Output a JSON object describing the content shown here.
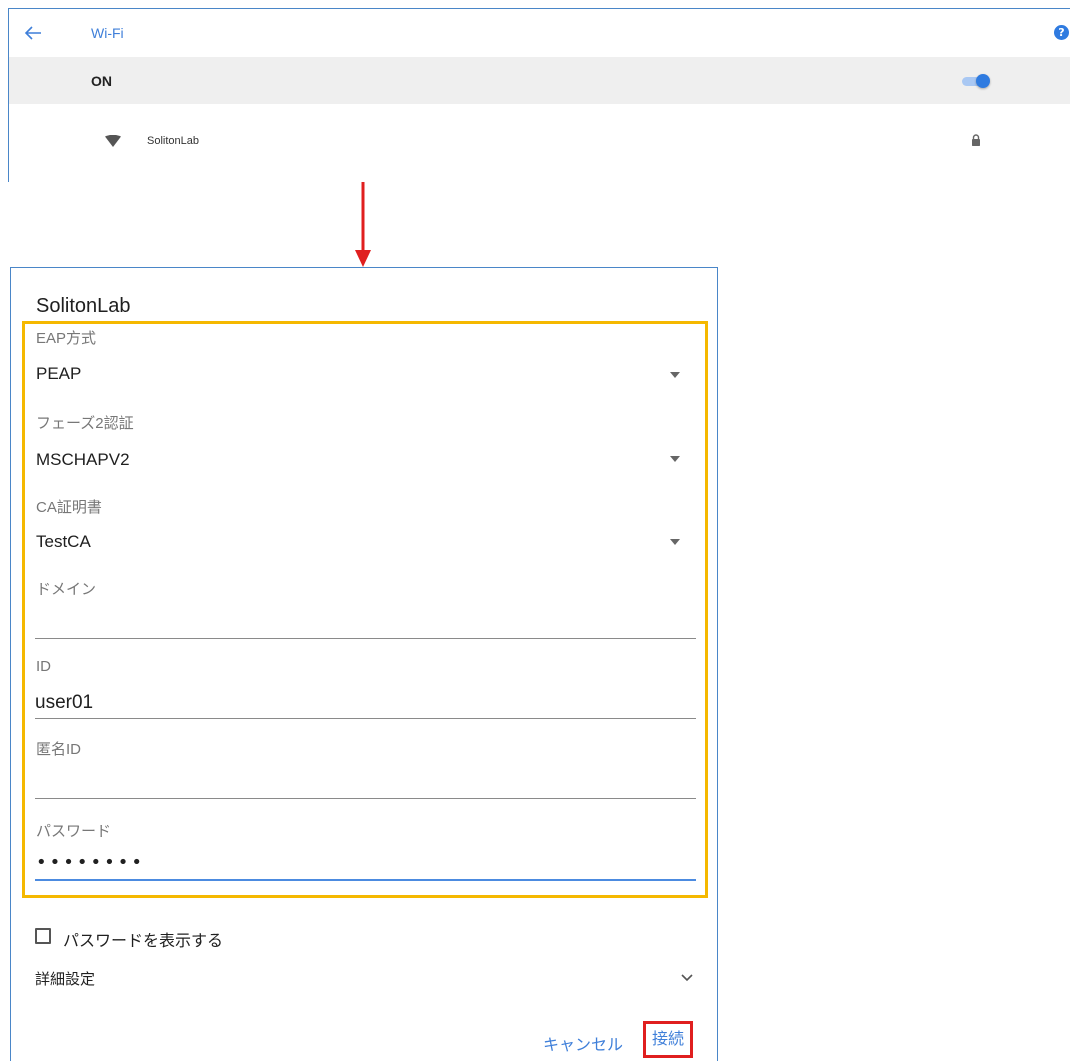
{
  "wifi_panel": {
    "title": "Wi-Fi",
    "help_glyph": "?",
    "toggle_label": "ON",
    "toggle_on": true,
    "network_name": "SolitonLab",
    "accent_color": "#2f7be0"
  },
  "dialog": {
    "title": "SolitonLab",
    "eap": {
      "label": "EAP方式",
      "value": "PEAP"
    },
    "phase2": {
      "label": "フェーズ2認証",
      "value": "MSCHAPV2"
    },
    "ca_cert": {
      "label": "CA証明書",
      "value": "TestCA"
    },
    "domain": {
      "label": "ドメイン",
      "value": ""
    },
    "identity": {
      "label": "ID",
      "value": "user01"
    },
    "anonymous_id": {
      "label": "匿名ID",
      "value": ""
    },
    "password": {
      "label": "パスワード",
      "value": "••••••••"
    },
    "show_password": {
      "label": "パスワードを表示する",
      "checked": false
    },
    "advanced": {
      "label": "詳細設定"
    },
    "cancel_label": "キャンセル",
    "connect_label": "接続",
    "highlight_color": "#f5b800",
    "connect_highlight_color": "#e01f1f"
  }
}
